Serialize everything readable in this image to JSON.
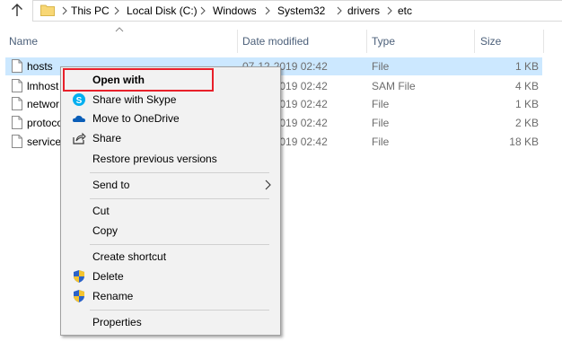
{
  "address_bar": {
    "breadcrumbs": [
      "This PC",
      "Local Disk (C:)",
      "Windows",
      "System32",
      "drivers",
      "etc"
    ]
  },
  "columns": {
    "name": "Name",
    "date_modified": "Date modified",
    "type": "Type",
    "size": "Size"
  },
  "files": [
    {
      "name": "hosts",
      "date": "07-12-2019 02:42",
      "type": "File",
      "size": "1 KB"
    },
    {
      "name": "lmhost",
      "date": "07-12-2019 02:42",
      "type": "SAM File",
      "size": "4 KB"
    },
    {
      "name": "networ",
      "date": "07-12-2019 02:42",
      "type": "File",
      "size": "1 KB"
    },
    {
      "name": "protoco",
      "date": "07-12-2019 02:42",
      "type": "File",
      "size": "2 KB"
    },
    {
      "name": "service",
      "date": "07-12-2019 02:42",
      "type": "File",
      "size": "18 KB"
    }
  ],
  "context_menu": {
    "open_with": "Open with",
    "share_with_skype": "Share with Skype",
    "move_to_onedrive": "Move to OneDrive",
    "share": "Share",
    "restore_previous_versions": "Restore previous versions",
    "send_to": "Send to",
    "cut": "Cut",
    "copy": "Copy",
    "create_shortcut": "Create shortcut",
    "delete": "Delete",
    "rename": "Rename",
    "properties": "Properties"
  },
  "colors": {
    "selection": "#cce8ff",
    "highlight_border": "#e8202a",
    "header_text": "#4c607a"
  }
}
